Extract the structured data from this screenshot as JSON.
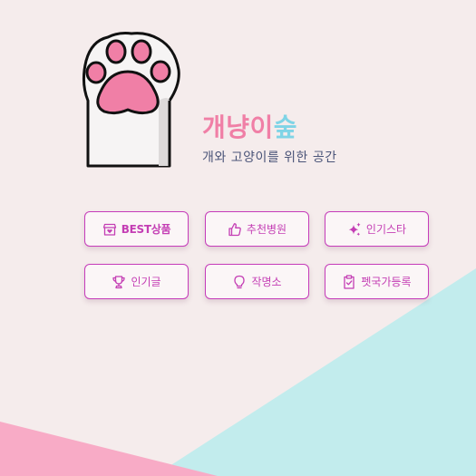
{
  "brand": {
    "title_part1": "개냥이",
    "title_part2": "숲",
    "subtitle": "개와 고양이를 위한 공간"
  },
  "menu": [
    {
      "label": "BEST상품",
      "icon": "store-heart-icon"
    },
    {
      "label": "추천병원",
      "icon": "thumbs-up-icon"
    },
    {
      "label": "인기스타",
      "icon": "sparkle-icon"
    },
    {
      "label": "인기글",
      "icon": "trophy-icon"
    },
    {
      "label": "작명소",
      "icon": "lightbulb-icon"
    },
    {
      "label": "펫국가등록",
      "icon": "clipboard-check-icon"
    }
  ],
  "colors": {
    "background": "#f5ecec",
    "title_pink": "#f07fa6",
    "title_cyan": "#7fd4e6",
    "button_accent": "#c63cba",
    "shape_cyan": "#c2eced",
    "shape_pink": "#f8abc6"
  }
}
